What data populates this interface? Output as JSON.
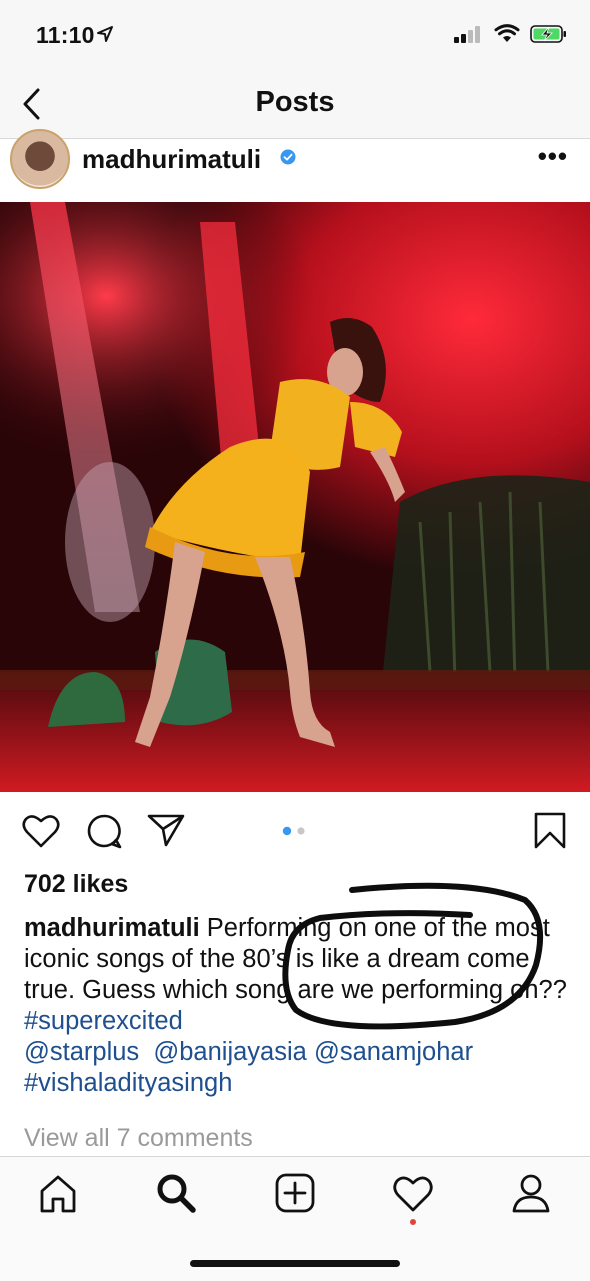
{
  "status": {
    "time": "11:10"
  },
  "nav": {
    "title": "Posts"
  },
  "post": {
    "username": "madhurimatuli",
    "likes": "702 likes",
    "caption": {
      "user": "madhurimatuli",
      "text1": " Performing on one of the most iconic songs of the 80’s is like a dream come true. Guess which song are we performing on?? ",
      "tags": [
        "#superexcited",
        "@starplus",
        "@banijayasia",
        "@sanamjohar",
        "#vishaladityasingh"
      ]
    },
    "view_comments": "View all 7 comments",
    "carousel": {
      "count": 2,
      "active": 1
    }
  },
  "icons": {
    "back": "chevron-left-icon",
    "verified": "verified-badge-icon",
    "more": "more-icon",
    "like": "heart-icon",
    "comment": "comment-icon",
    "share": "send-icon",
    "save": "bookmark-icon",
    "tabs": [
      "home-icon",
      "search-icon",
      "add-post-icon",
      "activity-heart-icon",
      "profile-icon"
    ]
  },
  "colors": {
    "accent": "#3897f0",
    "notification_dot": "#e0443b",
    "link": "#1e4f8f"
  }
}
